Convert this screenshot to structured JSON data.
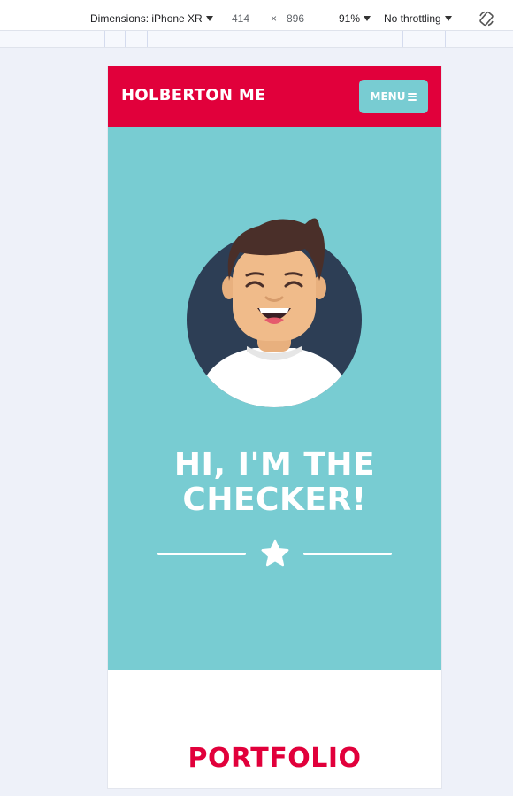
{
  "devtools": {
    "device_label": "Dimensions: iPhone XR",
    "width": "414",
    "times": "×",
    "height": "896",
    "zoom": "91%",
    "throttling": "No throttling"
  },
  "site": {
    "brand": "HOLBERTON ME",
    "menu_label": "MENU",
    "hero_title_line1": "HI, I'M THE",
    "hero_title_line2": "CHECKER!",
    "section_title": "PORTFOLIO"
  },
  "colors": {
    "primary_red": "#e1003b",
    "teal": "#78ccd2",
    "white": "#ffffff"
  },
  "icons": {
    "menu": "hamburger-icon",
    "star": "star-icon",
    "rotate": "rotate-device-icon"
  }
}
